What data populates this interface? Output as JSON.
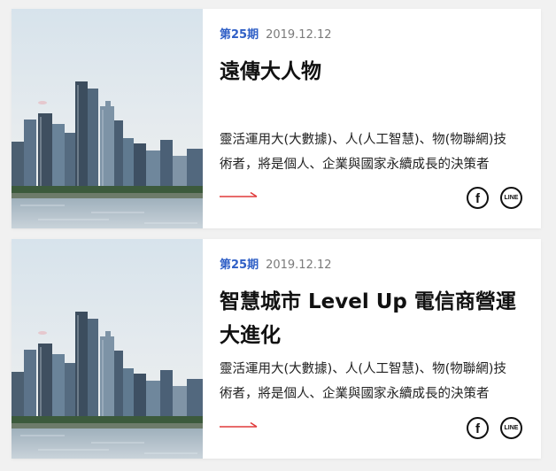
{
  "cards": [
    {
      "issue": "第25期",
      "date": "2019.12.12",
      "title": "遠傳大人物",
      "excerpt": "靈活運用大(大數據)、人(人工智慧)、物(物聯網)技術者，將是個人、企業與國家永續成長的決策者",
      "share": {
        "facebook_glyph": "f",
        "line_glyph": "LINE"
      },
      "icons": {
        "arrow": "arrow-right-icon",
        "facebook": "facebook-icon",
        "line": "line-icon"
      }
    },
    {
      "issue": "第25期",
      "date": "2019.12.12",
      "title": "智慧城市 Level Up 電信商營運大進化",
      "excerpt": "靈活運用大(大數據)、人(人工智慧)、物(物聯網)技術者，將是個人、企業與國家永續成長的決策者",
      "share": {
        "facebook_glyph": "f",
        "line_glyph": "LINE"
      },
      "icons": {
        "arrow": "arrow-right-icon",
        "facebook": "facebook-icon",
        "line": "line-icon"
      }
    }
  ],
  "colors": {
    "accent": "#2f5fc6",
    "arrow": "#e03a3a",
    "background": "#f1f1f1"
  }
}
